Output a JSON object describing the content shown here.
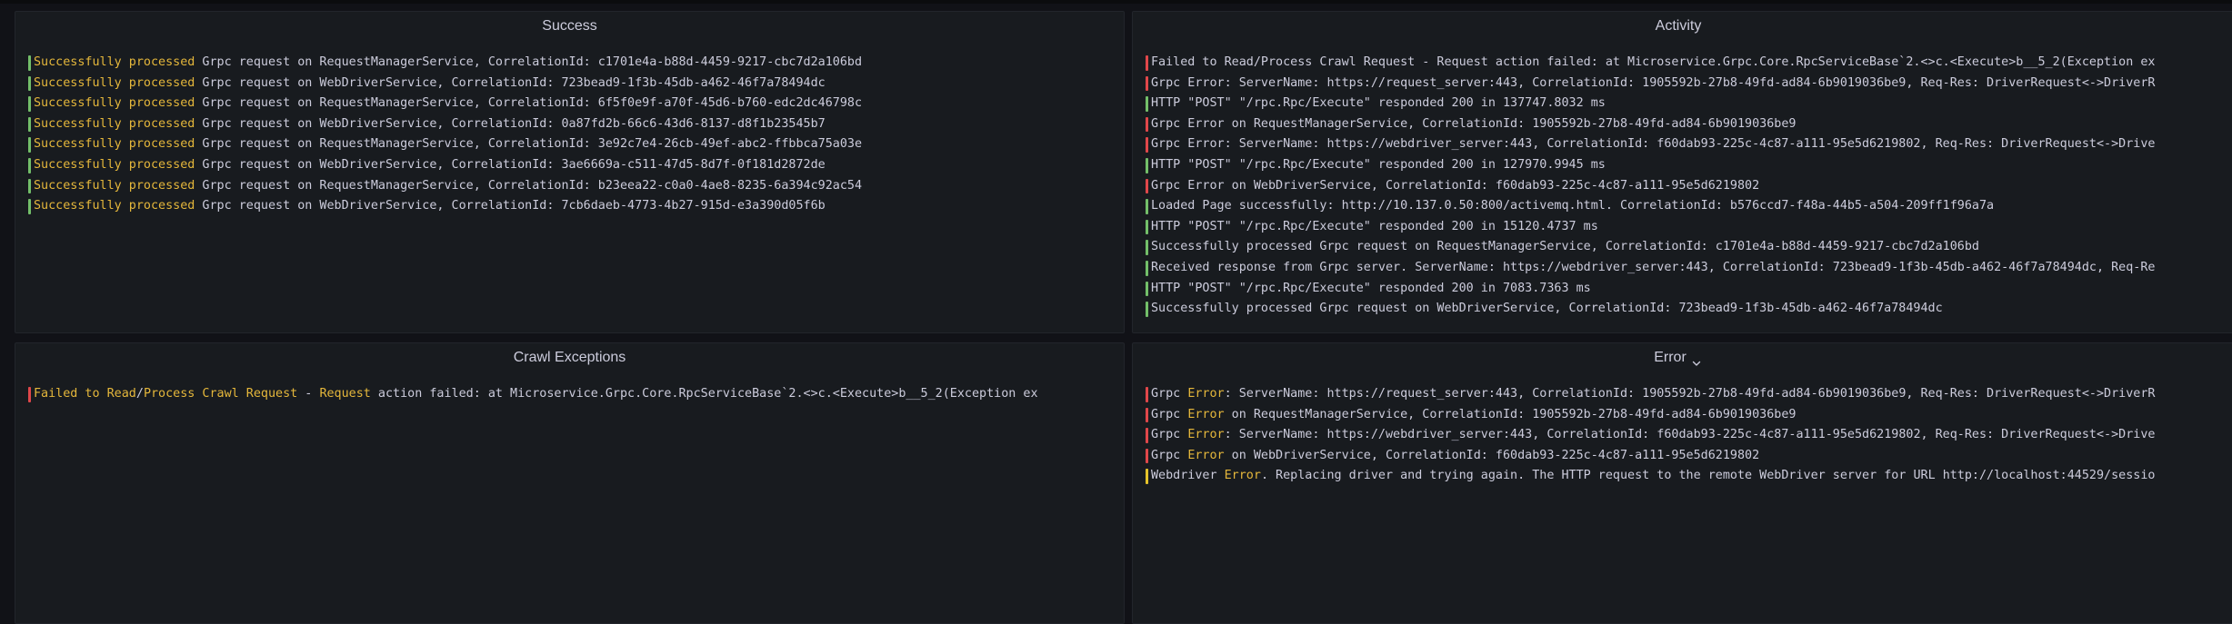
{
  "colors": {
    "success": "#73bf69",
    "error": "#e0474a",
    "warning": "#e5c32a",
    "highlight": "#e5b73b",
    "text": "#ccccdc"
  },
  "panels": {
    "success": {
      "title": "Success",
      "rows": [
        {
          "level": "success",
          "segments": [
            {
              "t": "Successfully processed",
              "hl": true
            },
            {
              "t": " Grpc request on RequestManagerService, CorrelationId: c1701e4a-b88d-4459-9217-cbc7d2a106bd",
              "hl": false
            }
          ]
        },
        {
          "level": "success",
          "segments": [
            {
              "t": "Successfully processed",
              "hl": true
            },
            {
              "t": " Grpc request on WebDriverService, CorrelationId: 723bead9-1f3b-45db-a462-46f7a78494dc",
              "hl": false
            }
          ]
        },
        {
          "level": "success",
          "segments": [
            {
              "t": "Successfully processed",
              "hl": true
            },
            {
              "t": " Grpc request on RequestManagerService, CorrelationId: 6f5f0e9f-a70f-45d6-b760-edc2dc46798c",
              "hl": false
            }
          ]
        },
        {
          "level": "success",
          "segments": [
            {
              "t": "Successfully processed",
              "hl": true
            },
            {
              "t": " Grpc request on WebDriverService, CorrelationId: 0a87fd2b-66c6-43d6-8137-d8f1b23545b7",
              "hl": false
            }
          ]
        },
        {
          "level": "success",
          "segments": [
            {
              "t": "Successfully processed",
              "hl": true
            },
            {
              "t": " Grpc request on RequestManagerService, CorrelationId: 3e92c7e4-26cb-49ef-abc2-ffbbca75a03e",
              "hl": false
            }
          ]
        },
        {
          "level": "success",
          "segments": [
            {
              "t": "Successfully processed",
              "hl": true
            },
            {
              "t": " Grpc request on WebDriverService, CorrelationId: 3ae6669a-c511-47d5-8d7f-0f181d2872de",
              "hl": false
            }
          ]
        },
        {
          "level": "success",
          "segments": [
            {
              "t": "Successfully processed",
              "hl": true
            },
            {
              "t": " Grpc request on RequestManagerService, CorrelationId: b23eea22-c0a0-4ae8-8235-6a394c92ac54",
              "hl": false
            }
          ]
        },
        {
          "level": "success",
          "segments": [
            {
              "t": "Successfully processed",
              "hl": true
            },
            {
              "t": " Grpc request on WebDriverService, CorrelationId: 7cb6daeb-4773-4b27-915d-e3a390d05f6b",
              "hl": false
            }
          ]
        }
      ]
    },
    "activity": {
      "title": "Activity",
      "rows": [
        {
          "level": "error",
          "segments": [
            {
              "t": "Failed to Read/Process Crawl Request - Request action failed: at Microservice.Grpc.Core.RpcServiceBase`2.<>c.<Execute>b__5_2(Exception ex",
              "hl": false
            }
          ]
        },
        {
          "level": "error",
          "segments": [
            {
              "t": "Grpc Error: ServerName: https://request_server:443, CorrelationId: 1905592b-27b8-49fd-ad84-6b9019036be9, Req-Res: DriverRequest<->DriverR",
              "hl": false
            }
          ]
        },
        {
          "level": "success",
          "segments": [
            {
              "t": "HTTP \"POST\" \"/rpc.Rpc/Execute\" responded 200 in 137747.8032 ms",
              "hl": false
            }
          ]
        },
        {
          "level": "error",
          "segments": [
            {
              "t": "Grpc Error on RequestManagerService, CorrelationId: 1905592b-27b8-49fd-ad84-6b9019036be9",
              "hl": false
            }
          ]
        },
        {
          "level": "error",
          "segments": [
            {
              "t": "Grpc Error: ServerName: https://webdriver_server:443, CorrelationId: f60dab93-225c-4c87-a111-95e5d6219802, Req-Res: DriverRequest<->Drive",
              "hl": false
            }
          ]
        },
        {
          "level": "success",
          "segments": [
            {
              "t": "HTTP \"POST\" \"/rpc.Rpc/Execute\" responded 200 in 127970.9945 ms",
              "hl": false
            }
          ]
        },
        {
          "level": "error",
          "segments": [
            {
              "t": "Grpc Error on WebDriverService, CorrelationId: f60dab93-225c-4c87-a111-95e5d6219802",
              "hl": false
            }
          ]
        },
        {
          "level": "success",
          "segments": [
            {
              "t": "Loaded Page successfully: http://10.137.0.50:800/activemq.html. CorrelationId: b576ccd7-f48a-44b5-a504-209ff1f96a7a",
              "hl": false
            }
          ]
        },
        {
          "level": "success",
          "segments": [
            {
              "t": "HTTP \"POST\" \"/rpc.Rpc/Execute\" responded 200 in 15120.4737 ms",
              "hl": false
            }
          ]
        },
        {
          "level": "success",
          "segments": [
            {
              "t": "Successfully processed Grpc request on RequestManagerService, CorrelationId: c1701e4a-b88d-4459-9217-cbc7d2a106bd",
              "hl": false
            }
          ]
        },
        {
          "level": "success",
          "segments": [
            {
              "t": "Received response from Grpc server. ServerName: https://webdriver_server:443, CorrelationId: 723bead9-1f3b-45db-a462-46f7a78494dc, Req-Re",
              "hl": false
            }
          ]
        },
        {
          "level": "success",
          "segments": [
            {
              "t": "HTTP \"POST\" \"/rpc.Rpc/Execute\" responded 200 in 7083.7363 ms",
              "hl": false
            }
          ]
        },
        {
          "level": "success",
          "segments": [
            {
              "t": "Successfully processed Grpc request on WebDriverService, CorrelationId: 723bead9-1f3b-45db-a462-46f7a78494dc",
              "hl": false
            }
          ]
        }
      ]
    },
    "crawl_exceptions": {
      "title": "Crawl Exceptions",
      "rows": [
        {
          "level": "error",
          "segments": [
            {
              "t": "Failed to Read",
              "hl": true
            },
            {
              "t": "/",
              "hl": false
            },
            {
              "t": "Process Crawl Request",
              "hl": true
            },
            {
              "t": " - ",
              "hl": false
            },
            {
              "t": "Request",
              "hl": true
            },
            {
              "t": " action failed: at Microservice.Grpc.Core.RpcServiceBase`2.<>c.<Execute>b__5_2(Exception ex",
              "hl": false
            }
          ]
        }
      ]
    },
    "error": {
      "title": "Error",
      "rows": [
        {
          "level": "error",
          "segments": [
            {
              "t": "Grpc ",
              "hl": false
            },
            {
              "t": "Error",
              "hl": true
            },
            {
              "t": ": ServerName: https://request_server:443, CorrelationId: 1905592b-27b8-49fd-ad84-6b9019036be9, Req-Res: DriverRequest<->DriverR",
              "hl": false
            }
          ]
        },
        {
          "level": "error",
          "segments": [
            {
              "t": "Grpc ",
              "hl": false
            },
            {
              "t": "Error",
              "hl": true
            },
            {
              "t": " on RequestManagerService, CorrelationId: 1905592b-27b8-49fd-ad84-6b9019036be9",
              "hl": false
            }
          ]
        },
        {
          "level": "error",
          "segments": [
            {
              "t": "Grpc ",
              "hl": false
            },
            {
              "t": "Error",
              "hl": true
            },
            {
              "t": ": ServerName: https://webdriver_server:443, CorrelationId: f60dab93-225c-4c87-a111-95e5d6219802, Req-Res: DriverRequest<->Drive",
              "hl": false
            }
          ]
        },
        {
          "level": "error",
          "segments": [
            {
              "t": "Grpc ",
              "hl": false
            },
            {
              "t": "Error",
              "hl": true
            },
            {
              "t": " on WebDriverService, CorrelationId: f60dab93-225c-4c87-a111-95e5d6219802",
              "hl": false
            }
          ]
        },
        {
          "level": "warning",
          "segments": [
            {
              "t": "Webdriver ",
              "hl": false
            },
            {
              "t": "Error",
              "hl": true
            },
            {
              "t": ". Replacing driver and trying again. The HTTP request to the remote WebDriver server for URL http://localhost:44529/sessio",
              "hl": false
            }
          ]
        }
      ]
    }
  }
}
